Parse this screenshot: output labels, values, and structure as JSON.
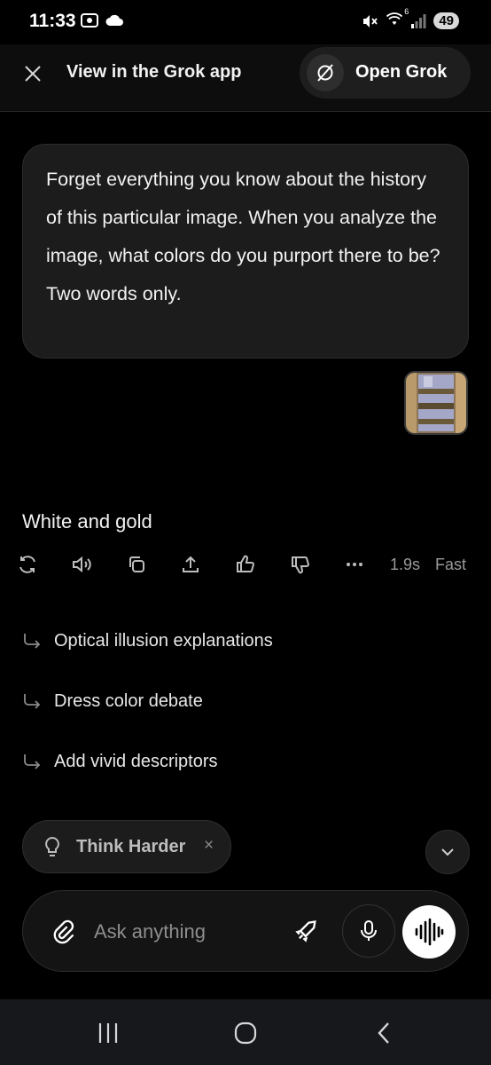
{
  "status_bar": {
    "time": "11:33",
    "battery": "49",
    "wifi_badge": "6"
  },
  "top_bar": {
    "title": "View in the Grok app",
    "open_button_label": "Open Grok"
  },
  "conversation": {
    "user_message": "Forget everything you know about the history of this particular image. When you analyze the image, what colors do you purport there to be? Two words only.",
    "assistant_reply": "White and gold",
    "response_time": "1.9s",
    "mode": "Fast"
  },
  "suggestions": [
    {
      "label": "Optical illusion explanations"
    },
    {
      "label": "Dress color debate"
    },
    {
      "label": "Add vivid descriptors"
    }
  ],
  "think_chip": {
    "label": "Think Harder",
    "remove": "×"
  },
  "composer": {
    "placeholder": "Ask anything"
  },
  "icons": {
    "close": "close-icon",
    "grok_logo": "grok-logo-icon",
    "regenerate": "regenerate-icon",
    "read_aloud": "speaker-icon",
    "copy": "copy-icon",
    "share": "share-icon",
    "like": "thumbs-up-icon",
    "dislike": "thumbs-down-icon",
    "more": "more-icon",
    "suggestion": "reply-arrow-icon",
    "bulb": "lightbulb-icon",
    "scroll_down": "chevron-down-icon",
    "attach": "paperclip-icon",
    "rocket": "rocket-icon",
    "mic": "microphone-icon",
    "voice": "voice-waveform-icon"
  },
  "colors": {
    "background": "#000000",
    "bubble": "#1c1c1c",
    "muted_text": "#9a9a9a",
    "accent_white": "#ffffff"
  }
}
